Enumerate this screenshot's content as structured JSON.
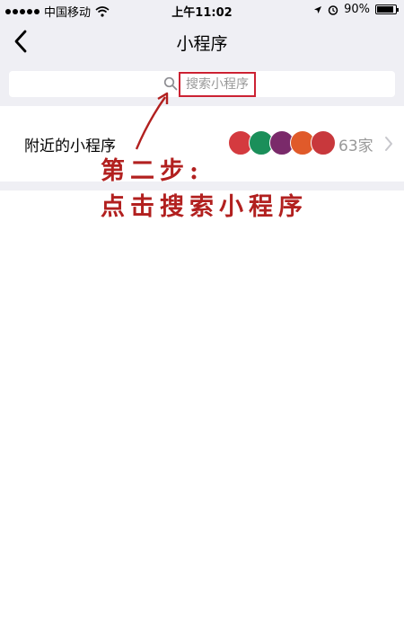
{
  "status_bar": {
    "carrier": "中国移动",
    "time": "上午11:02",
    "battery": "90%",
    "battery_level": 0.9,
    "icons": [
      "signal-dots-icon",
      "wifi-icon",
      "location-icon",
      "alarm-icon",
      "battery-icon"
    ]
  },
  "nav": {
    "title": "小程序",
    "back_icon": "chevron-left-icon"
  },
  "search": {
    "placeholder": "搜索小程序",
    "icon": "search-icon"
  },
  "nearby_row": {
    "label": "附近的小程序",
    "count": "63家",
    "icon_colors": [
      "#d43a3f",
      "#1b8f5a",
      "#7a2a6a",
      "#e05a2a",
      "#c8383c"
    ],
    "chevron": "chevron-right-icon"
  },
  "annotation": {
    "line1": "第二步:",
    "line2": "点击搜索小程序",
    "color": "#b2201f"
  }
}
